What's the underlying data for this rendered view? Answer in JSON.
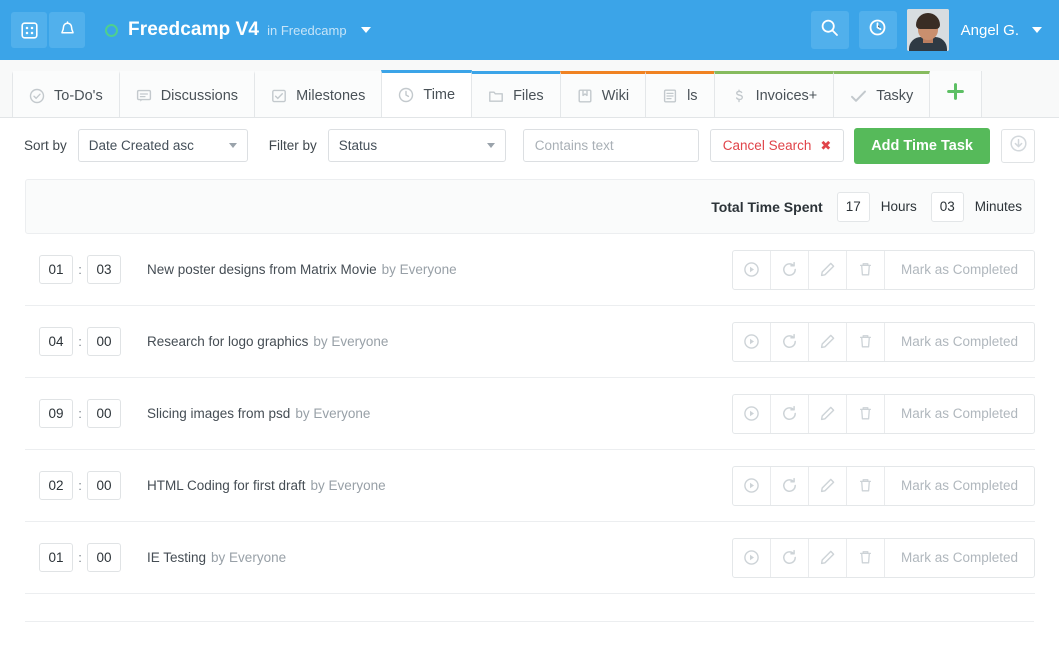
{
  "topbar": {
    "apps_icon": "grid-apps-icon",
    "bell_icon": "bell-notifications-icon",
    "project_name": "Freedcamp V4",
    "project_context": "in Freedcamp",
    "project_status_color": "#4ecf8f",
    "search_icon": "search-icon",
    "timer_icon": "clock-timer-icon",
    "user_name": "Angel G.",
    "avatar_alt": "user-avatar",
    "bg_color": "#3ba4e8"
  },
  "tabs": [
    {
      "label": "To-Do's",
      "icon": "check-circle-icon",
      "accent": "none",
      "active": false
    },
    {
      "label": "Discussions",
      "icon": "comment-icon",
      "accent": "none",
      "active": false
    },
    {
      "label": "Milestones",
      "icon": "checkbox-icon",
      "accent": "none",
      "active": false
    },
    {
      "label": "Time",
      "icon": "clock-icon",
      "accent": "blue",
      "active": true
    },
    {
      "label": "Files",
      "icon": "folder-icon",
      "accent": "blue",
      "active": false
    },
    {
      "label": "Wiki",
      "icon": "book-icon",
      "accent": "orange",
      "active": false
    },
    {
      "label": "ls",
      "icon": "list-lines-icon",
      "accent": "orange",
      "active": false
    },
    {
      "label": "Invoices+",
      "icon": "dollar-icon",
      "accent": "green",
      "active": false
    },
    {
      "label": "Tasky",
      "icon": "checkmark-icon",
      "accent": "green",
      "active": false
    }
  ],
  "tab_add": {
    "icon": "plus-icon",
    "color": "#5cbf63"
  },
  "toolbar": {
    "sort_label": "Sort by",
    "sort_value": "Date Created asc",
    "filter_label": "Filter by",
    "filter_value": "Status",
    "search_placeholder": "Contains text",
    "search_value": "",
    "search_icon": "search-icon",
    "cancel_search": "Cancel Search",
    "cancel_search_x": "✖",
    "cancel_search_color": "#e0444a",
    "add_button": "Add Time Task",
    "add_button_color": "#56ba5a",
    "download_icon": "download-circle-icon"
  },
  "total": {
    "label": "Total Time Spent",
    "hours_value": "17",
    "hours_unit": "Hours",
    "minutes_value": "03",
    "minutes_unit": "Minutes"
  },
  "row_actions": {
    "play_icon": "play-circle-icon",
    "restart_icon": "refresh-icon",
    "edit_icon": "pencil-edit-icon",
    "delete_icon": "trash-icon",
    "complete_label": "Mark as Completed"
  },
  "tasks": [
    {
      "hours": "01",
      "minutes": "03",
      "separator": ":",
      "title": "New poster designs from Matrix Movie",
      "by": "by Everyone"
    },
    {
      "hours": "04",
      "minutes": "00",
      "separator": ":",
      "title": "Research for logo graphics",
      "by": "by Everyone"
    },
    {
      "hours": "09",
      "minutes": "00",
      "separator": ":",
      "title": "Slicing images from psd",
      "by": "by Everyone"
    },
    {
      "hours": "02",
      "minutes": "00",
      "separator": ":",
      "title": "HTML Coding for first draft",
      "by": "by Everyone"
    },
    {
      "hours": "01",
      "minutes": "00",
      "separator": ":",
      "title": "IE Testing",
      "by": "by Everyone"
    }
  ]
}
